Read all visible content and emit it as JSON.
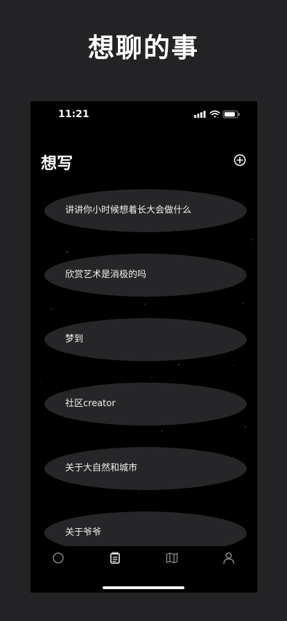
{
  "promo": {
    "title": "想聊的事"
  },
  "status_bar": {
    "time": "11:21"
  },
  "header": {
    "title": "想写"
  },
  "topics": [
    {
      "label": "讲讲你小时候想着长大会做什么"
    },
    {
      "label": "欣赏艺术是消极的吗"
    },
    {
      "label": "梦到"
    },
    {
      "label": "社区creator"
    },
    {
      "label": "关于大自然和城市"
    },
    {
      "label": "关于爷爷"
    }
  ],
  "tab_bar": {
    "tabs": [
      {
        "icon": "circle-icon",
        "active": false
      },
      {
        "icon": "notepad-icon",
        "active": true
      },
      {
        "icon": "map-icon",
        "active": false
      },
      {
        "icon": "person-icon",
        "active": false
      }
    ]
  },
  "colors": {
    "background": "#232325",
    "screen": "#000000",
    "card": "#262628",
    "text": "#ffffff",
    "inactive_icon": "#8a8a8e"
  }
}
